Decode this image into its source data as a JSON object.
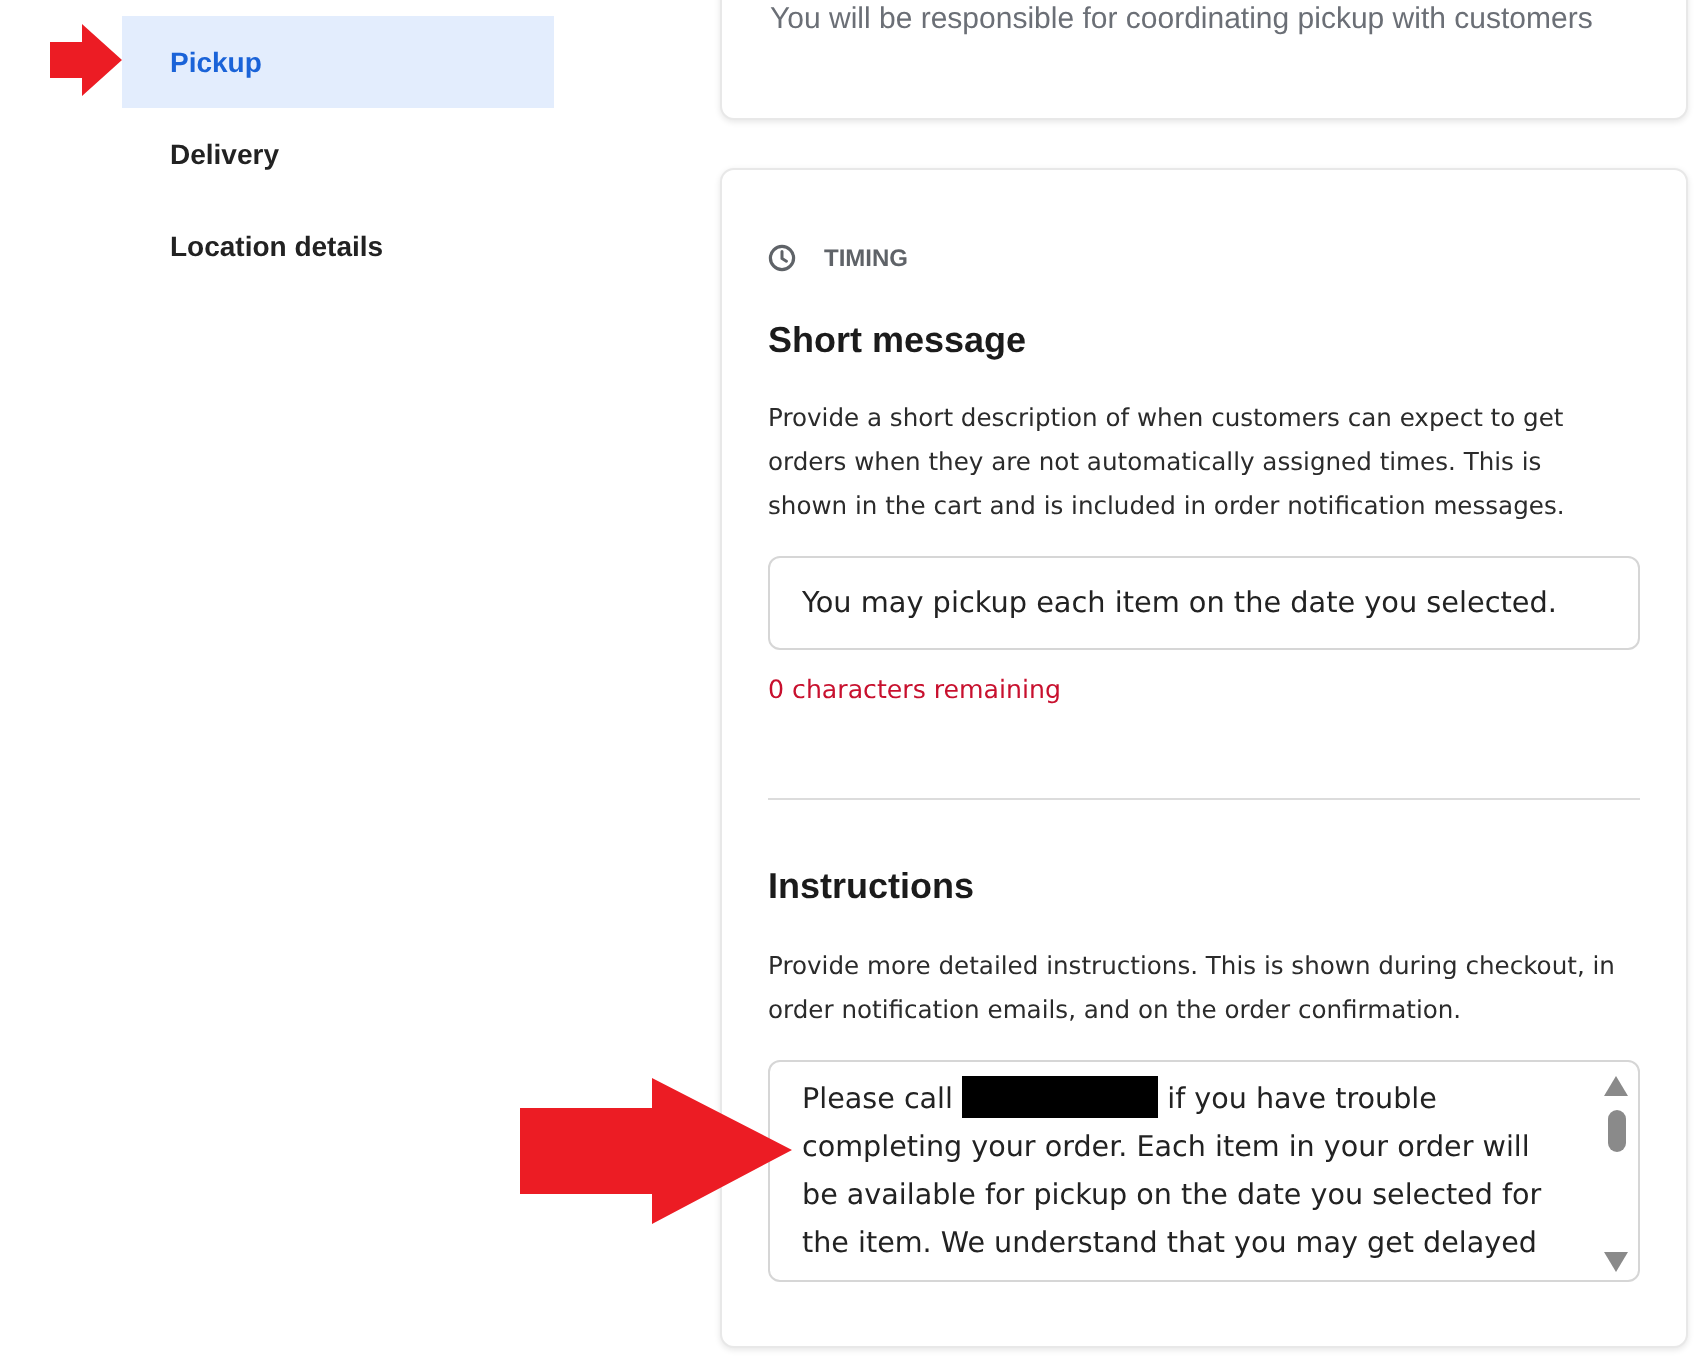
{
  "sidebar": {
    "items": [
      {
        "label": "Pickup",
        "selected": true
      },
      {
        "label": "Delivery",
        "selected": false
      },
      {
        "label": "Location details",
        "selected": false
      }
    ]
  },
  "pickup_card": {
    "note": "You will be responsible for coordinating pickup with customers"
  },
  "timing_card": {
    "section_label": "TIMING",
    "short_message": {
      "title": "Short message",
      "description": "Provide a short description of when customers can expect to get orders when they are not automatically assigned times. This is shown in the cart and is included in order notification messages.",
      "value": "You may pickup each item on the date you selected.",
      "counter": "0 characters remaining",
      "counter_warning": true
    },
    "instructions": {
      "title": "Instructions",
      "description": "Provide more detailed instructions. This is shown during checkout, in order notification emails, and on the order confirmation.",
      "value_parts": [
        {
          "kind": "text",
          "text": "Please call"
        },
        {
          "kind": "redacted"
        },
        {
          "kind": "text",
          "text": "if you have trouble completing your order. Each item in your order will be available for pickup on the date you selected for the item. We understand that you may get delayed"
        }
      ]
    }
  }
}
